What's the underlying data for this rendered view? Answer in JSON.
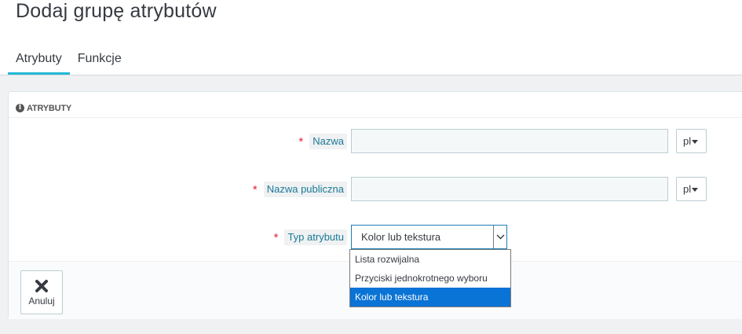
{
  "header": {
    "title": "Dodaj grupę atrybutów",
    "tabs": [
      {
        "label": "Atrybuty",
        "active": true
      },
      {
        "label": "Funkcje",
        "active": false
      }
    ]
  },
  "panel": {
    "heading_icon": "info-icon",
    "heading": "ATRYBUTY",
    "fields": {
      "name": {
        "required_mark": "*",
        "label": "Nazwa",
        "value": "",
        "language": "pl"
      },
      "public_name": {
        "required_mark": "*",
        "label": "Nazwa publiczna",
        "value": "",
        "language": "pl"
      },
      "type": {
        "required_mark": "*",
        "label": "Typ atrybutu",
        "selected": "Kolor lub tekstura"
      }
    },
    "type_options": [
      {
        "label": "Lista rozwijalna",
        "selected": false
      },
      {
        "label": "Przyciski jednokrotnego wyboru",
        "selected": false
      },
      {
        "label": "Kolor lub tekstura",
        "selected": true
      }
    ],
    "footer": {
      "cancel_label": "Anuluj",
      "cancel_icon": "close-icon"
    }
  },
  "colors": {
    "accent": "#25b9d7",
    "label_text": "#1a7a98",
    "required": "#e0253a",
    "selected_option_bg": "#0a73d6"
  }
}
